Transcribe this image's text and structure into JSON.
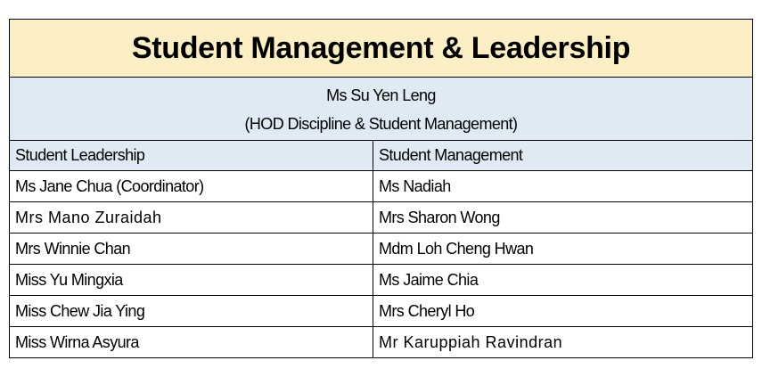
{
  "title": "Student Management & Leadership",
  "hod": {
    "name": "Ms Su Yen Leng",
    "role": "(HOD Discipline & Student Management)"
  },
  "columns": {
    "left_header": "Student Leadership",
    "right_header": "Student Management"
  },
  "rows": [
    {
      "left": "Ms Jane Chua (Coordinator)",
      "right": "Ms Nadiah"
    },
    {
      "left": "Mrs Mano Zuraidah",
      "right": "Mrs Sharon Wong"
    },
    {
      "left": "Mrs Winnie Chan",
      "right": "Mdm Loh Cheng Hwan"
    },
    {
      "left": "Miss Yu Mingxia",
      "right": "Ms Jaime Chia"
    },
    {
      "left": "Miss Chew Jia Ying",
      "right": "Mrs Cheryl Ho"
    },
    {
      "left": "Miss Wirna Asyura",
      "right": "Mr Karuppiah Ravindran"
    }
  ],
  "colors": {
    "title_background": "#fcefc5",
    "header_background": "#dfeaf5",
    "border": "#000000"
  }
}
